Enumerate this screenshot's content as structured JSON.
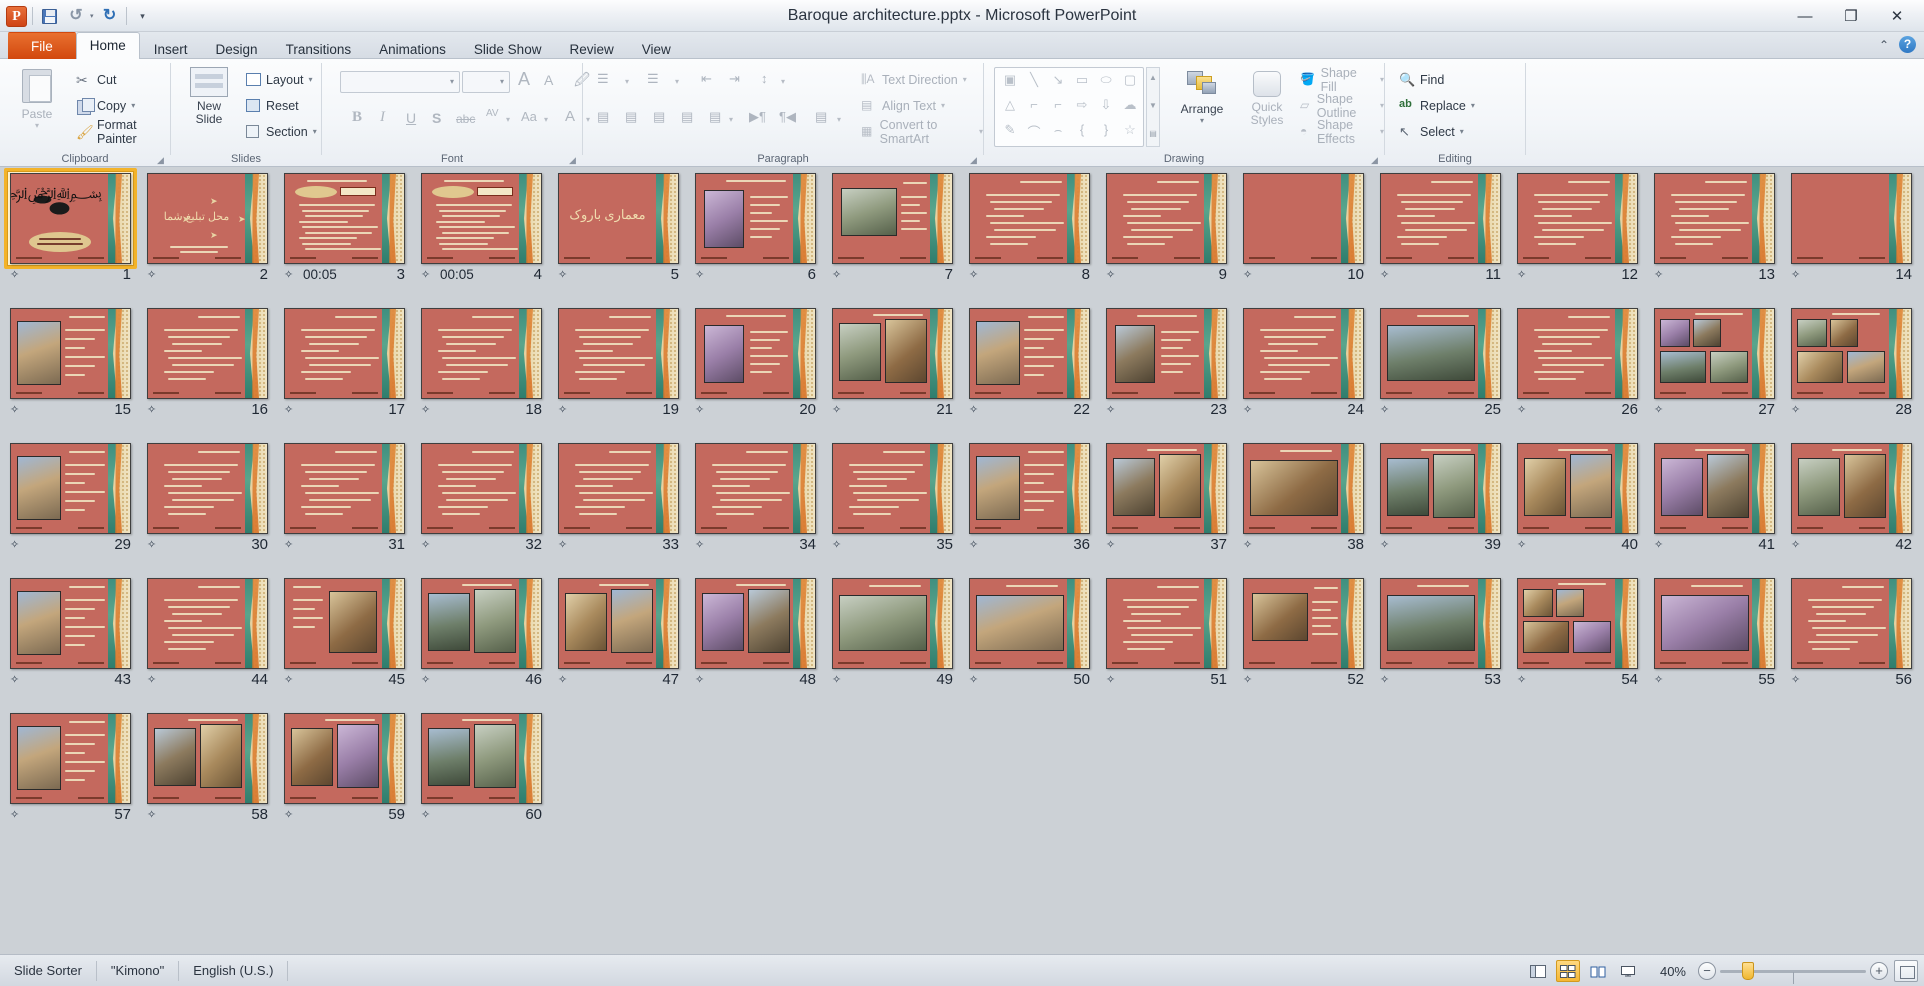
{
  "window": {
    "title": "Baroque architecture.pptx  -  Microsoft PowerPoint",
    "minimize": "—",
    "restore": "❐",
    "close": "✕"
  },
  "quick_access": {
    "app_logo": "P",
    "save": "save-icon",
    "undo": "↺",
    "undo_caret": "▾",
    "redo": "↻",
    "customize": "▾"
  },
  "ribbon_right": {
    "collapse": "⌃",
    "help": "?"
  },
  "tabs": [
    {
      "label": "File",
      "type": "file"
    },
    {
      "label": "Home",
      "type": "active"
    },
    {
      "label": "Insert",
      "type": "normal"
    },
    {
      "label": "Design",
      "type": "normal"
    },
    {
      "label": "Transitions",
      "type": "normal"
    },
    {
      "label": "Animations",
      "type": "normal"
    },
    {
      "label": "Slide Show",
      "type": "normal"
    },
    {
      "label": "Review",
      "type": "normal"
    },
    {
      "label": "View",
      "type": "normal"
    }
  ],
  "ribbon": {
    "groups": [
      {
        "label": "Clipboard"
      },
      {
        "label": "Slides"
      },
      {
        "label": "Font"
      },
      {
        "label": "Paragraph"
      },
      {
        "label": "Drawing"
      },
      {
        "label": "Editing"
      }
    ],
    "clipboard": {
      "paste": "Paste",
      "paste_caret": "▾",
      "cut": "Cut",
      "copy": "Copy",
      "copy_caret": "▾",
      "format_painter": "Format Painter"
    },
    "slides": {
      "new_slide_line1": "New",
      "new_slide_line2": "Slide",
      "new_slide_caret": "▾",
      "layout": "Layout",
      "layout_caret": "▾",
      "reset": "Reset",
      "section": "Section",
      "section_caret": "▾"
    },
    "font": {
      "font_name_value": "",
      "font_name_placeholder": "",
      "font_size_value": "",
      "grow_font": "A",
      "shrink_font": "A",
      "clear_formatting": "clear-formatting-icon",
      "bold": "B",
      "italic": "I",
      "underline": "U",
      "shadow": "S",
      "strikethrough": "abc",
      "character_spacing": "AV",
      "change_case": "Aa",
      "font_color": "A"
    },
    "paragraph": {
      "text_direction": "Text Direction",
      "align_text": "Align Text",
      "convert_to_smartart": "Convert to SmartArt"
    },
    "drawing": {
      "arrange": "Arrange",
      "arrange_caret": "▾",
      "quick_styles_line1": "Quick",
      "quick_styles_line2": "Styles",
      "quick_styles_caret": "▾",
      "shape_fill": "Shape Fill",
      "shape_outline": "Shape Outline",
      "shape_effects": "Shape Effects"
    },
    "editing": {
      "find": "Find",
      "replace": "Replace",
      "replace_caret": "▾",
      "select": "Select",
      "select_caret": "▾"
    }
  },
  "slide_sorter": {
    "selected_slide": 1,
    "transition_icon": "transition-star-icon",
    "slides": [
      {
        "n": 1,
        "timing": "",
        "layout": "bismillah",
        "title": "",
        "images": 0
      },
      {
        "n": 2,
        "timing": "",
        "layout": "promo",
        "title": "محل تبلیغ شما",
        "images": 0
      },
      {
        "n": 3,
        "timing": "00:05",
        "layout": "textdense",
        "title": "",
        "images": 0
      },
      {
        "n": 4,
        "timing": "00:05",
        "layout": "textdense",
        "title": "",
        "images": 0
      },
      {
        "n": 5,
        "timing": "",
        "layout": "bigtitle",
        "title": "معماری باروک",
        "images": 0
      },
      {
        "n": 6,
        "timing": "",
        "layout": "textimg",
        "title": "سبک باروک (1600-1750) م",
        "images": 1
      },
      {
        "n": 7,
        "timing": "",
        "layout": "imgtop",
        "title": "",
        "images": 1
      },
      {
        "n": 8,
        "timing": "",
        "layout": "text",
        "title": "",
        "images": 0
      },
      {
        "n": 9,
        "timing": "",
        "layout": "text",
        "title": "",
        "images": 0
      },
      {
        "n": 10,
        "timing": "",
        "layout": "plain",
        "title": "",
        "images": 0
      },
      {
        "n": 11,
        "timing": "",
        "layout": "text",
        "title": "",
        "images": 0
      },
      {
        "n": 12,
        "timing": "",
        "layout": "text",
        "title": "",
        "images": 0
      },
      {
        "n": 13,
        "timing": "",
        "layout": "text",
        "title": "",
        "images": 0
      },
      {
        "n": 14,
        "timing": "",
        "layout": "plain",
        "title": "",
        "images": 0
      },
      {
        "n": 15,
        "timing": "",
        "layout": "imgleft",
        "title": "",
        "images": 1
      },
      {
        "n": 16,
        "timing": "",
        "layout": "text",
        "title": "",
        "images": 0
      },
      {
        "n": 17,
        "timing": "",
        "layout": "text",
        "title": "",
        "images": 0
      },
      {
        "n": 18,
        "timing": "",
        "layout": "text",
        "title": "",
        "images": 0
      },
      {
        "n": 19,
        "timing": "",
        "layout": "text",
        "title": "",
        "images": 0
      },
      {
        "n": 20,
        "timing": "",
        "layout": "textimg",
        "title": "",
        "images": 1
      },
      {
        "n": 21,
        "timing": "",
        "layout": "twoimg",
        "title": "",
        "images": 2
      },
      {
        "n": 22,
        "timing": "",
        "layout": "imgleft",
        "title": "",
        "images": 1
      },
      {
        "n": 23,
        "timing": "",
        "layout": "textimg",
        "title": "",
        "images": 1
      },
      {
        "n": 24,
        "timing": "",
        "layout": "text",
        "title": "",
        "images": 0
      },
      {
        "n": 25,
        "timing": "",
        "layout": "imgwide",
        "title": "",
        "images": 1
      },
      {
        "n": 26,
        "timing": "",
        "layout": "text",
        "title": "",
        "images": 0
      },
      {
        "n": 27,
        "timing": "",
        "layout": "multiimg",
        "title": "",
        "images": 3
      },
      {
        "n": 28,
        "timing": "",
        "layout": "multiimg",
        "title": "",
        "images": 2
      },
      {
        "n": 29,
        "timing": "",
        "layout": "imgleft",
        "title": "",
        "images": 1
      },
      {
        "n": 30,
        "timing": "",
        "layout": "text",
        "title": "",
        "images": 0
      },
      {
        "n": 31,
        "timing": "",
        "layout": "text",
        "title": "",
        "images": 0
      },
      {
        "n": 32,
        "timing": "",
        "layout": "text",
        "title": "",
        "images": 0
      },
      {
        "n": 33,
        "timing": "",
        "layout": "text",
        "title": "",
        "images": 0
      },
      {
        "n": 34,
        "timing": "",
        "layout": "text",
        "title": "",
        "images": 0
      },
      {
        "n": 35,
        "timing": "",
        "layout": "text",
        "title": "",
        "images": 0
      },
      {
        "n": 36,
        "timing": "",
        "layout": "imgleft",
        "title": "",
        "images": 1
      },
      {
        "n": 37,
        "timing": "",
        "layout": "twoimg",
        "title": "",
        "images": 2
      },
      {
        "n": 38,
        "timing": "",
        "layout": "imgwide",
        "title": "",
        "images": 1
      },
      {
        "n": 39,
        "timing": "",
        "layout": "twoimg",
        "title": "",
        "images": 2
      },
      {
        "n": 40,
        "timing": "",
        "layout": "twoimg",
        "title": "",
        "images": 2
      },
      {
        "n": 41,
        "timing": "",
        "layout": "twoimg",
        "title": "",
        "images": 2
      },
      {
        "n": 42,
        "timing": "",
        "layout": "twoimg",
        "title": "",
        "images": 2
      },
      {
        "n": 43,
        "timing": "",
        "layout": "imgleft",
        "title": "",
        "images": 1
      },
      {
        "n": 44,
        "timing": "",
        "layout": "text",
        "title": "",
        "images": 0
      },
      {
        "n": 45,
        "timing": "",
        "layout": "imgright",
        "title": "",
        "images": 1
      },
      {
        "n": 46,
        "timing": "",
        "layout": "twoimg",
        "title": "",
        "images": 2
      },
      {
        "n": 47,
        "timing": "",
        "layout": "twoimg",
        "title": "",
        "images": 2
      },
      {
        "n": 48,
        "timing": "",
        "layout": "twoimg",
        "title": "",
        "images": 2
      },
      {
        "n": 49,
        "timing": "",
        "layout": "imgwide",
        "title": "",
        "images": 1
      },
      {
        "n": 50,
        "timing": "",
        "layout": "imgwide",
        "title": "",
        "images": 1
      },
      {
        "n": 51,
        "timing": "",
        "layout": "text",
        "title": "",
        "images": 0
      },
      {
        "n": 52,
        "timing": "",
        "layout": "imgtop",
        "title": "",
        "images": 1
      },
      {
        "n": 53,
        "timing": "",
        "layout": "imgwide",
        "title": "",
        "images": 1
      },
      {
        "n": 54,
        "timing": "",
        "layout": "multiimg",
        "title": "",
        "images": 2
      },
      {
        "n": 55,
        "timing": "",
        "layout": "imgwide",
        "title": "",
        "images": 1
      },
      {
        "n": 56,
        "timing": "",
        "layout": "text",
        "title": "",
        "images": 0
      },
      {
        "n": 57,
        "timing": "",
        "layout": "imgleft",
        "title": "",
        "images": 1
      },
      {
        "n": 58,
        "timing": "",
        "layout": "twoimg",
        "title": "",
        "images": 2
      },
      {
        "n": 59,
        "timing": "",
        "layout": "twoimg",
        "title": "",
        "images": 2
      },
      {
        "n": 60,
        "timing": "",
        "layout": "twoimg",
        "title": "",
        "images": 2
      }
    ]
  },
  "status_bar": {
    "view_name": "Slide Sorter",
    "theme": "\"Kimono\"",
    "language": "English (U.S.)",
    "zoom_percent": "40%",
    "zoom_out": "−",
    "zoom_in": "+",
    "views": [
      {
        "name": "normal-view",
        "active": false
      },
      {
        "name": "slide-sorter-view",
        "active": true
      },
      {
        "name": "reading-view",
        "active": false
      },
      {
        "name": "slide-show-view",
        "active": false
      }
    ],
    "fit_to_window": "fit-slide-to-window-icon"
  },
  "colors": {
    "slide_bg": "#c4695e",
    "accent_orange": "#d2480e",
    "selection": "#f3b32a",
    "chrome": "#ccd1d6"
  }
}
